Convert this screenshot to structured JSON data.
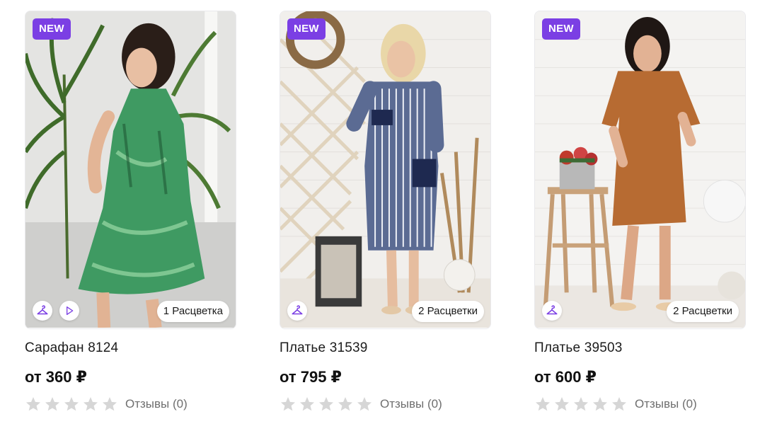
{
  "colors": {
    "accent": "#7b3fe4",
    "star_empty": "#d6d6d6"
  },
  "products": [
    {
      "badge": "NEW",
      "title": "Сарафан 8124",
      "price": "от 360 ₽",
      "colors_label": "1 Расцветка",
      "rating": 0,
      "reviews": "Отзывы (0)",
      "has_video": true,
      "photo": "green-print-sundress"
    },
    {
      "badge": "NEW",
      "title": "Платье 31539",
      "price": "от 795 ₽",
      "colors_label": "2 Расцветки",
      "rating": 0,
      "reviews": "Отзывы (0)",
      "has_video": false,
      "photo": "striped-shirt-dress"
    },
    {
      "badge": "NEW",
      "title": "Платье 39503",
      "price": "от 600 ₽",
      "colors_label": "2 Расцветки",
      "rating": 0,
      "reviews": "Отзывы (0)",
      "has_video": false,
      "photo": "terracotta-shift-dress"
    }
  ]
}
